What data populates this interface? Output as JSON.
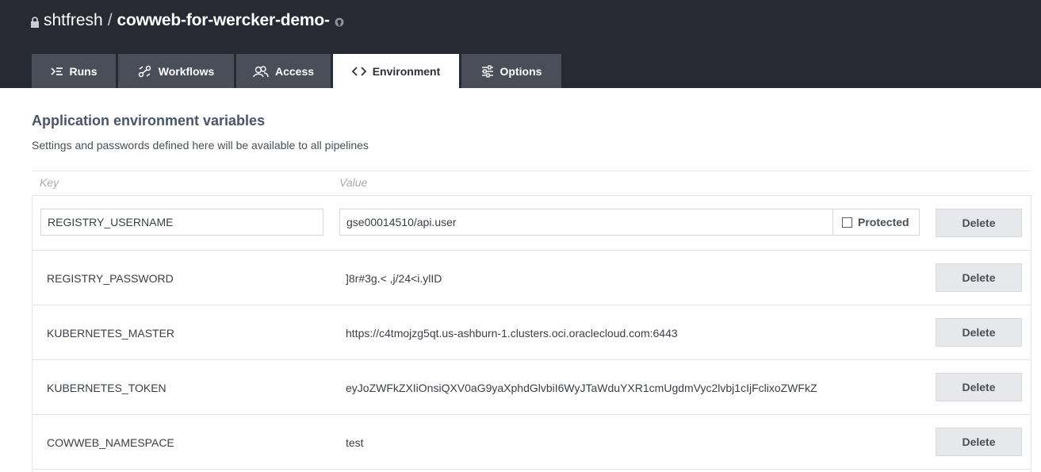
{
  "header": {
    "owner": "shtfresh",
    "separator": "/",
    "repo": "cowweb-for-wercker-demo-"
  },
  "tabs": [
    {
      "label": "Runs",
      "icon": "runs-icon"
    },
    {
      "label": "Workflows",
      "icon": "workflows-icon"
    },
    {
      "label": "Access",
      "icon": "access-icon"
    },
    {
      "label": "Environment",
      "icon": "code-icon",
      "active": true
    },
    {
      "label": "Options",
      "icon": "sliders-icon"
    }
  ],
  "section": {
    "title": "Application environment variables",
    "description": "Settings and passwords defined here will be available to all pipelines"
  },
  "columns": {
    "key": "Key",
    "value": "Value"
  },
  "new_row": {
    "key": "REGISTRY_USERNAME",
    "value": "gse00014510/api.user",
    "protected_label": "Protected",
    "delete_label": "Delete"
  },
  "variables": [
    {
      "key": "REGISTRY_PASSWORD",
      "value": "]8r#3g.<  ,j/24<i.ylID",
      "delete_label": "Delete"
    },
    {
      "key": "KUBERNETES_MASTER",
      "value": "https://c4tmojzg5qt.us-ashburn-1.clusters.oci.oraclecloud.com:6443",
      "delete_label": "Delete"
    },
    {
      "key": "KUBERNETES_TOKEN",
      "value": "eyJoZWFkZXIiOnsiQXV0aG9yaXphdGlvbiI6WyJTaWduYXR1cmUgdmVyc2lvbj1cIjFclixoZWFkZ",
      "delete_label": "Delete"
    },
    {
      "key": "COWWEB_NAMESPACE",
      "value": "test",
      "delete_label": "Delete"
    }
  ],
  "colors": {
    "topbar": "#272a33",
    "tab": "#4a4e58",
    "active_tab": "#ffffff",
    "button": "#e6e8eb"
  }
}
